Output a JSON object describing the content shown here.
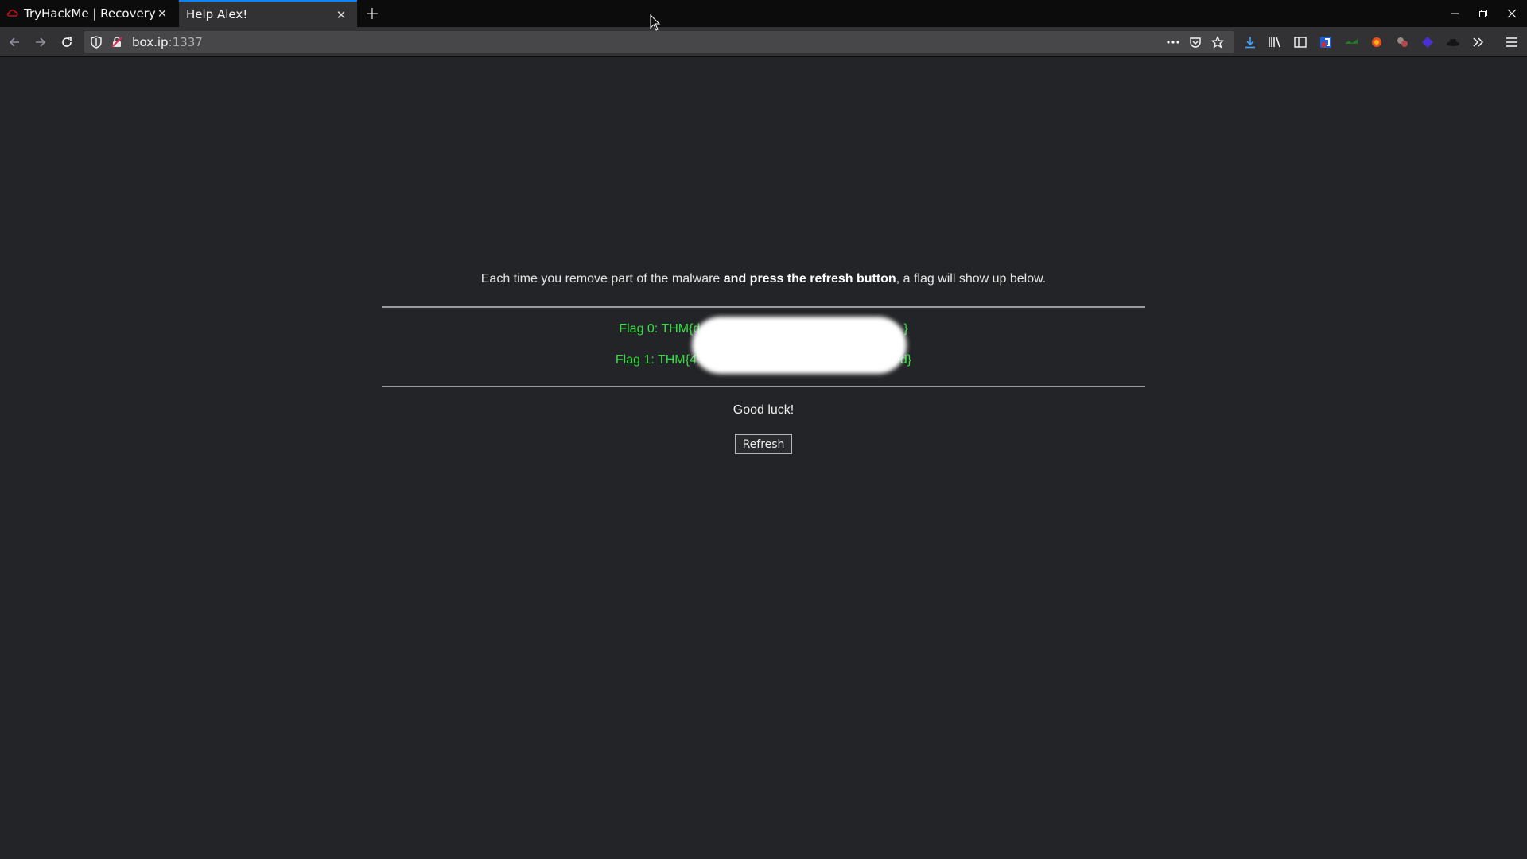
{
  "browser": {
    "tabs": [
      {
        "title": "TryHackMe | Recovery",
        "active": false
      },
      {
        "title": "Help Alex!",
        "active": true
      }
    ],
    "address": {
      "host": "box.ip",
      "port": ":1337"
    },
    "accent_color": "#0a84ff"
  },
  "page": {
    "intro_before": "Each time you remove part of the malware ",
    "intro_bold": "and press the refresh button",
    "intro_after": ", a flag will show up below.",
    "flags": [
      {
        "prefix": "Flag 0: THM{d",
        "suffix": "}"
      },
      {
        "prefix": "Flag 1: THM{4",
        "suffix": "d}"
      }
    ],
    "closing": "Good luck!",
    "refresh_label": "Refresh",
    "flag_color": "#33e03f"
  }
}
